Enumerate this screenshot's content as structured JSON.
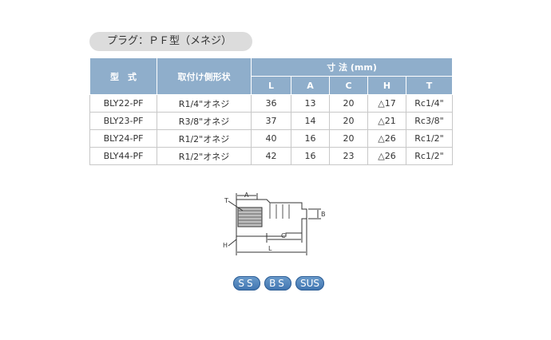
{
  "title": "プラグ：ＰＦ型（メネジ）",
  "table": {
    "col_model": "型　式",
    "col_mount": "取付け側形状",
    "dims_header": "寸 法 (mm)",
    "dim_cols": [
      "L",
      "A",
      "C",
      "H",
      "T"
    ],
    "rows": [
      {
        "model": "BLY22-PF",
        "mount": "R1/4\"オネジ",
        "L": "36",
        "A": "13",
        "C": "20",
        "H": "△17",
        "T": "Rc1/4\""
      },
      {
        "model": "BLY23-PF",
        "mount": "R3/8\"オネジ",
        "L": "37",
        "A": "14",
        "C": "20",
        "H": "△21",
        "T": "Rc3/8\""
      },
      {
        "model": "BLY24-PF",
        "mount": "R1/2\"オネジ",
        "L": "40",
        "A": "16",
        "C": "20",
        "H": "△26",
        "T": "Rc1/2\""
      },
      {
        "model": "BLY44-PF",
        "mount": "R1/2\"オネジ",
        "L": "42",
        "A": "16",
        "C": "23",
        "H": "△26",
        "T": "Rc1/2\""
      }
    ]
  },
  "diagram": {
    "labels": {
      "T": "T",
      "A": "A",
      "B": "B",
      "C": "C",
      "H": "H",
      "L": "L"
    }
  },
  "materials": [
    "SS",
    "BS",
    "SUS"
  ]
}
